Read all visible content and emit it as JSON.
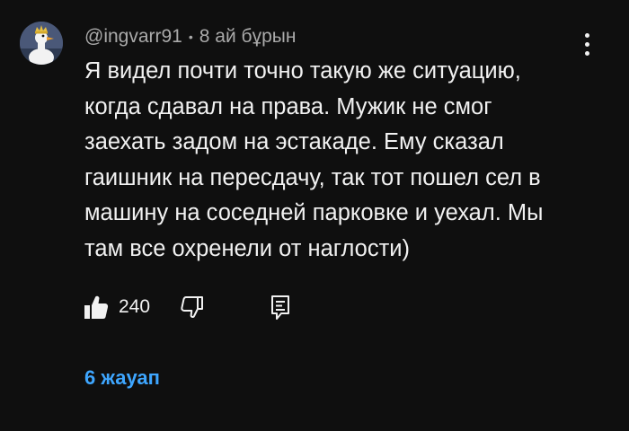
{
  "comment": {
    "author": "@ingvarr91",
    "separator": "•",
    "time_ago": "8 ай бұрын",
    "text_lines": [
      "Я видел почти точно такую же ситуацию,",
      "когда сдавал на права. Мужик не смог",
      "заехать задом на эстакаде. Ему сказал",
      "гаишник на пересдачу, так тот пошел сел в",
      "машину на соседней парковке и уехал. Мы",
      "там все охренели от наглости)"
    ],
    "like_count": "240",
    "replies_label": "6 жауап"
  },
  "icons": {
    "avatar": "goose-with-crown-avatar",
    "more": "more-vertical-icon",
    "like": "thumbs-up-filled-icon",
    "dislike": "thumbs-down-outline-icon",
    "reply": "reply-comment-icon"
  },
  "colors": {
    "background": "#0f0f0f",
    "text_primary": "#f1f1f1",
    "text_secondary": "#aaaaaa",
    "link_blue": "#3ea6ff"
  }
}
